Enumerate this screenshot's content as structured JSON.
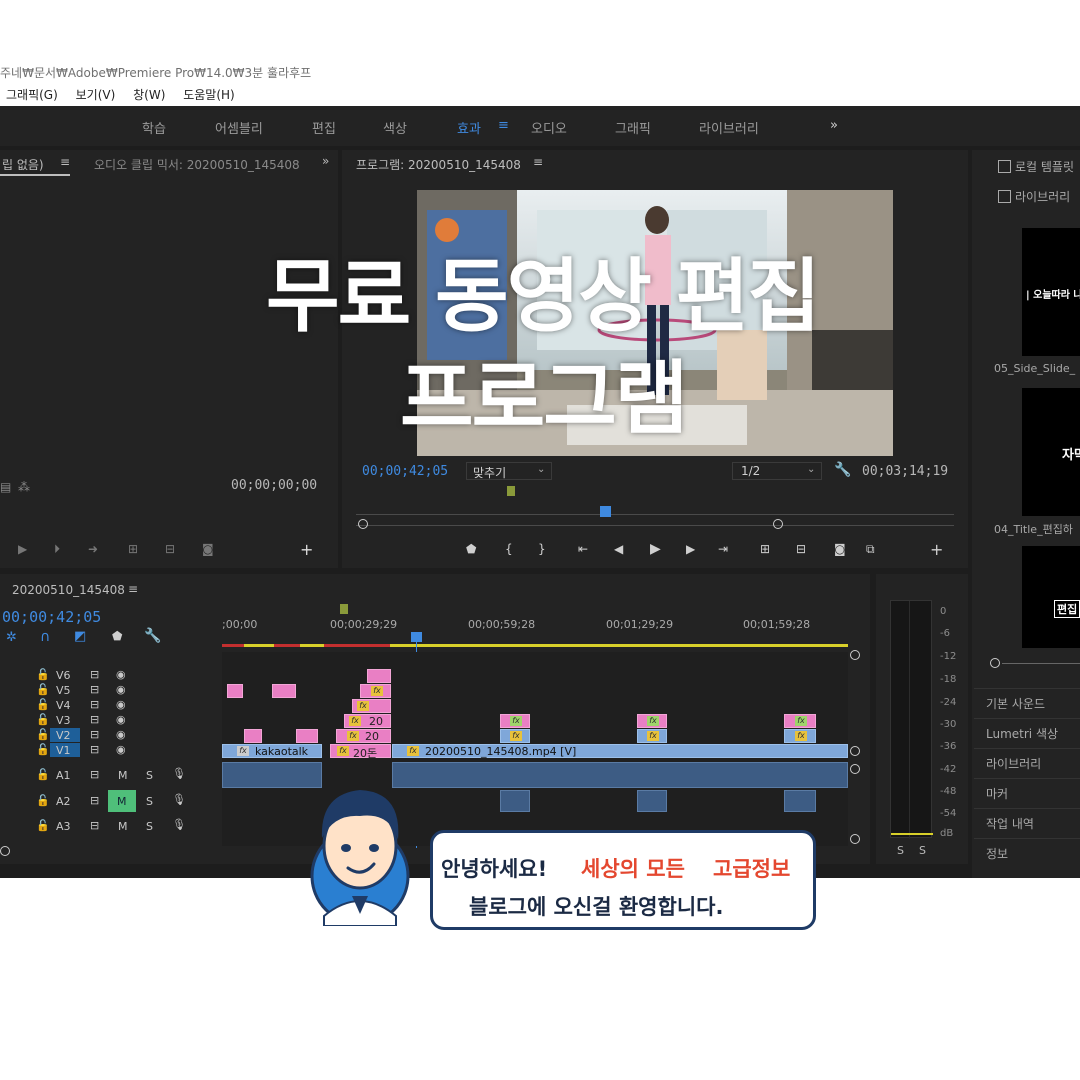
{
  "window": {
    "path": "주네₩문서₩Adobe₩Premiere Pro₩14.0₩3분 훌라후프",
    "menus": [
      "그래픽(G)",
      "보기(V)",
      "창(W)",
      "도움말(H)"
    ]
  },
  "workspaces": {
    "items": [
      "학습",
      "어셈블리",
      "편집",
      "색상",
      "효과",
      "오디오",
      "그래픽",
      "라이브러리"
    ],
    "active": "효과",
    "more": "»"
  },
  "source_panel": {
    "tab1": "립 없음)",
    "tab2": "오디오 클립 믹서: 20200510_145408",
    "more": "»",
    "timecode": "00;00;00;00"
  },
  "program_panel": {
    "title": "프로그램: 20200510_145408",
    "timecode_current": "00;00;42;05",
    "fit_label": "맞추기",
    "resolution": "1/2",
    "timecode_duration": "00;03;14;19"
  },
  "timeline": {
    "sequence_name": "20200510_145408",
    "current_time": "00;00;42;05",
    "ruler_labels": [
      ";00;00",
      "00;00;29;29",
      "00;00;59;28",
      "00;01;29;29",
      "00;01;59;28"
    ],
    "video_tracks": [
      "V6",
      "V5",
      "V4",
      "V3",
      "V2",
      "V1"
    ],
    "audio_tracks": [
      "A1",
      "A2",
      "A3"
    ],
    "clip_kakao": "kakaotalk",
    "clip_main": "20200510_145408.mp4 [V]",
    "clip_20a": "20",
    "clip_20b": "20",
    "clip_20c": "20돈",
    "m_label": "M",
    "s_label": "S"
  },
  "audio_meter": {
    "ticks": [
      "0",
      "-6",
      "-12",
      "-18",
      "-24",
      "-30",
      "-36",
      "-42",
      "-48",
      "-54",
      "dB"
    ],
    "solo": [
      "S",
      "S"
    ]
  },
  "right_panel": {
    "checkbox1": "로컬 템플릿",
    "checkbox2": "라이브러리",
    "thumb1_text": "| 오늘따라 나",
    "thumb1_label": "05_Side_Slide_",
    "thumb2_text": "자막",
    "thumb2_label": "04_Title_편집하",
    "thumb3_text": "편집",
    "panels": [
      "기본 사운드",
      "Lumetri 색상",
      "라이브러리",
      "마커",
      "작업 내역",
      "정보"
    ]
  },
  "overlay": {
    "title_line1": "무료 동영상 편집",
    "title_line2": "프로그램"
  },
  "bubble": {
    "line1_part1": "안녕하세요!",
    "line1_part2": "세상의 모든",
    "line1_part3": "고급정보",
    "line2": "블로그에 오신걸  환영합니다."
  },
  "colors": {
    "accent_blue": "#3f8ae0",
    "clip_pink": "#e97fc4",
    "clip_blue": "#7fa7d9",
    "bubble_red": "#e4472f",
    "bubble_navy": "#1f3b66"
  }
}
